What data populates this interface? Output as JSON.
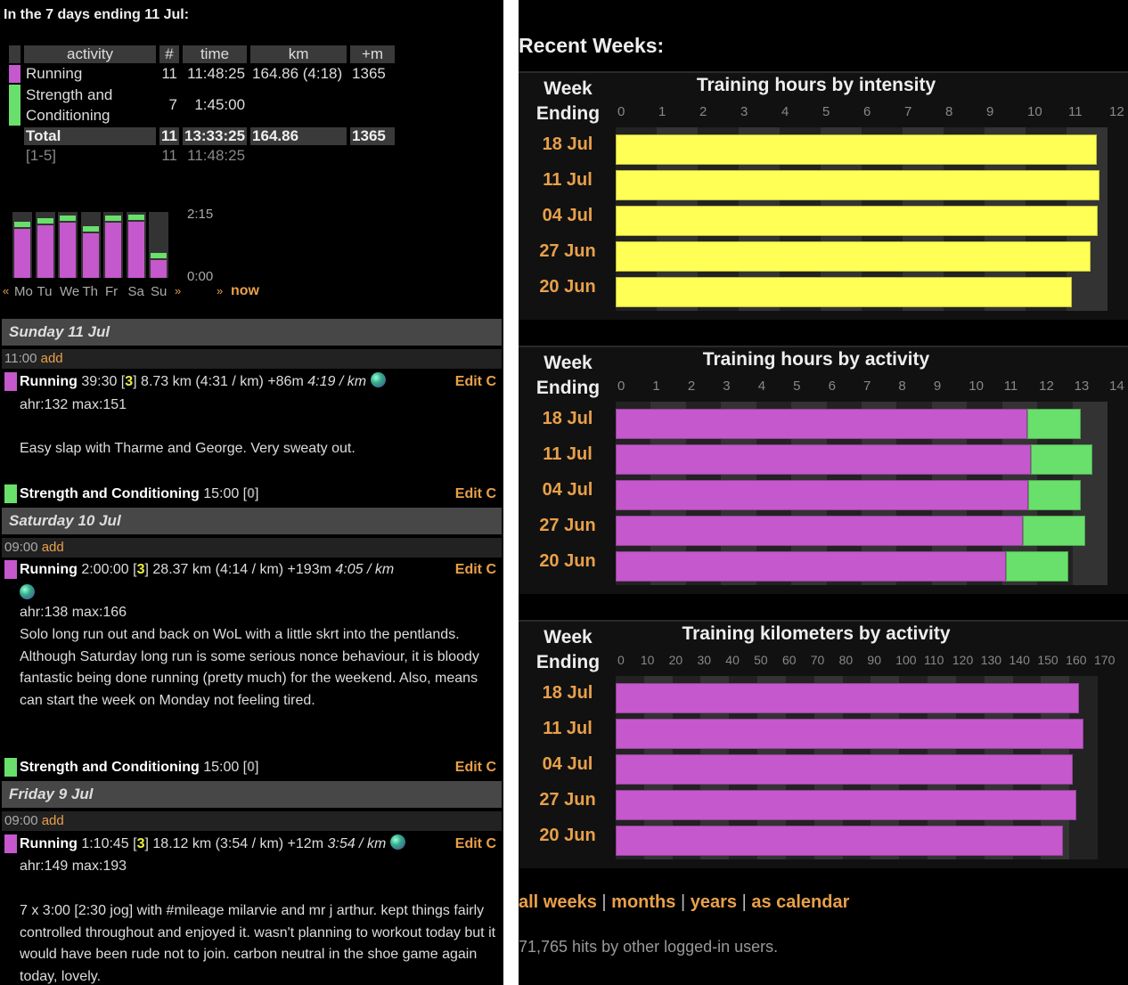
{
  "colors": {
    "running": "#c558cc",
    "strength": "#68e06b",
    "intensity": "#ffff55",
    "link": "#e8a04a"
  },
  "summary": {
    "title": "In the 7 days ending 11 Jul:",
    "headers": [
      "activity",
      "#",
      "time",
      "km",
      "+m"
    ],
    "rows": [
      {
        "activity": "Running",
        "count": "11",
        "time": "11:48:25",
        "km": "164.86 (4:18)",
        "m": "1365",
        "color": "running"
      },
      {
        "activity": "Strength and Conditioning",
        "count": "7",
        "time": "1:45:00",
        "km": "",
        "m": "",
        "color": "strength"
      }
    ],
    "total": {
      "label": "Total",
      "count": "11",
      "time": "13:33:25",
      "km": "164.86",
      "m": "1365"
    },
    "range": {
      "label": "[1-5]",
      "count": "11",
      "time": "11:48:25"
    }
  },
  "mini_chart": {
    "ymax_label": "2:15",
    "ymin_label": "0:00",
    "ymax_minutes": 135,
    "days": [
      "Mo",
      "Tu",
      "We",
      "Th",
      "Fr",
      "Sa",
      "Su"
    ],
    "running_minutes": [
      100,
      108,
      113,
      91,
      113,
      115,
      37
    ],
    "strength_minutes": [
      15,
      15,
      15,
      15,
      15,
      15,
      15
    ],
    "prev": "«",
    "next": "»",
    "now_arrow": "»",
    "now": "now"
  },
  "days": [
    {
      "title": "Sunday 11 Jul",
      "slot": "11:00",
      "add": "add"
    },
    {
      "title": "Saturday 10 Jul",
      "slot": "09:00",
      "add": "add"
    },
    {
      "title": "Friday 9 Jul",
      "slot": "09:00",
      "add": "add"
    }
  ],
  "activities": [
    {
      "name": "Running",
      "pre": " 39:30 [",
      "int": "3",
      "post": "] 8.73 km (4:31 / km) +86m ",
      "pace": "4:19 / km",
      "hr": "ahr:132 max:151",
      "note": "Easy slap with Tharme and George. Very sweaty out.",
      "edit": "Edit C"
    },
    {
      "name": "Strength and Conditioning",
      "pre": " 15:00 [",
      "int": "0",
      "post": "]",
      "edit": "Edit C"
    },
    {
      "name": "Running",
      "pre": " 2:00:00 [",
      "int": "3",
      "post": "] 28.37 km (4:14 / km) +193m ",
      "pace": "4:05 / km",
      "hr": "ahr:138 max:166",
      "note": "Solo long run out and back on WoL with a little skrt into the pentlands. Although Saturday long run is some serious nonce behaviour, it is bloody fantastic being done running (pretty much) for the weekend. Also, means can start the week on Monday not feeling tired.",
      "edit": "Edit C"
    },
    {
      "name": "Strength and Conditioning",
      "pre": " 15:00 [",
      "int": "0",
      "post": "]",
      "edit": "Edit C"
    },
    {
      "name": "Running",
      "pre": " 1:10:45 [",
      "int": "3",
      "post": "] 18.12 km (3:54 / km) +12m ",
      "pace": "3:54 / km",
      "hr": "ahr:149 max:193",
      "note": "7 x 3:00 [2:30 jog] with #mileage milarvie and mr j arthur. kept things fairly controlled throughout and enjoyed it. wasn't planning to workout today but it would have been rude not to join. carbon neutral in the shoe game again today, lovely.",
      "edit": "Edit C"
    }
  ],
  "recent": {
    "title": "Recent Weeks:",
    "week_label1": "Week",
    "week_label2": "Ending"
  },
  "chart_data": [
    {
      "type": "bar",
      "title": "Training hours by intensity",
      "ylabel": "Week Ending",
      "categories": [
        "18 Jul",
        "11 Jul",
        "04 Jul",
        "27 Jun",
        "20 Jun"
      ],
      "xlim": [
        0,
        12
      ],
      "ticks": [
        0,
        1,
        2,
        3,
        4,
        5,
        6,
        7,
        8,
        9,
        10,
        11,
        12
      ],
      "series": [
        {
          "name": "intensity",
          "color": "intensity",
          "values": [
            11.73,
            11.81,
            11.76,
            11.59,
            11.14
          ]
        }
      ]
    },
    {
      "type": "bar",
      "title": "Training hours by activity",
      "ylabel": "Week Ending",
      "categories": [
        "18 Jul",
        "11 Jul",
        "04 Jul",
        "27 Jun",
        "20 Jun"
      ],
      "xlim": [
        0,
        14
      ],
      "ticks": [
        0,
        1,
        2,
        3,
        4,
        5,
        6,
        7,
        8,
        9,
        10,
        11,
        12,
        13,
        14
      ],
      "series": [
        {
          "name": "Running",
          "color": "running",
          "values": [
            11.72,
            11.81,
            11.74,
            11.58,
            11.12
          ]
        },
        {
          "name": "Strength and Conditioning",
          "color": "strength",
          "values": [
            1.52,
            1.75,
            1.5,
            1.78,
            1.77
          ]
        }
      ]
    },
    {
      "type": "bar",
      "title": "Training kilometers by activity",
      "ylabel": "Week Ending",
      "categories": [
        "18 Jul",
        "11 Jul",
        "04 Jul",
        "27 Jun",
        "20 Jun"
      ],
      "xlim": [
        0,
        170
      ],
      "ticks": [
        0,
        10,
        20,
        30,
        40,
        50,
        60,
        70,
        80,
        90,
        100,
        110,
        120,
        130,
        140,
        150,
        160,
        170
      ],
      "series": [
        {
          "name": "Running",
          "color": "running",
          "values": [
            163.3,
            164.86,
            161.1,
            162.6,
            157.9
          ]
        }
      ]
    }
  ],
  "links": [
    "all weeks",
    "months",
    "years",
    "as calendar"
  ],
  "link_sep": "|",
  "hits": "71,765 hits by other logged-in users."
}
